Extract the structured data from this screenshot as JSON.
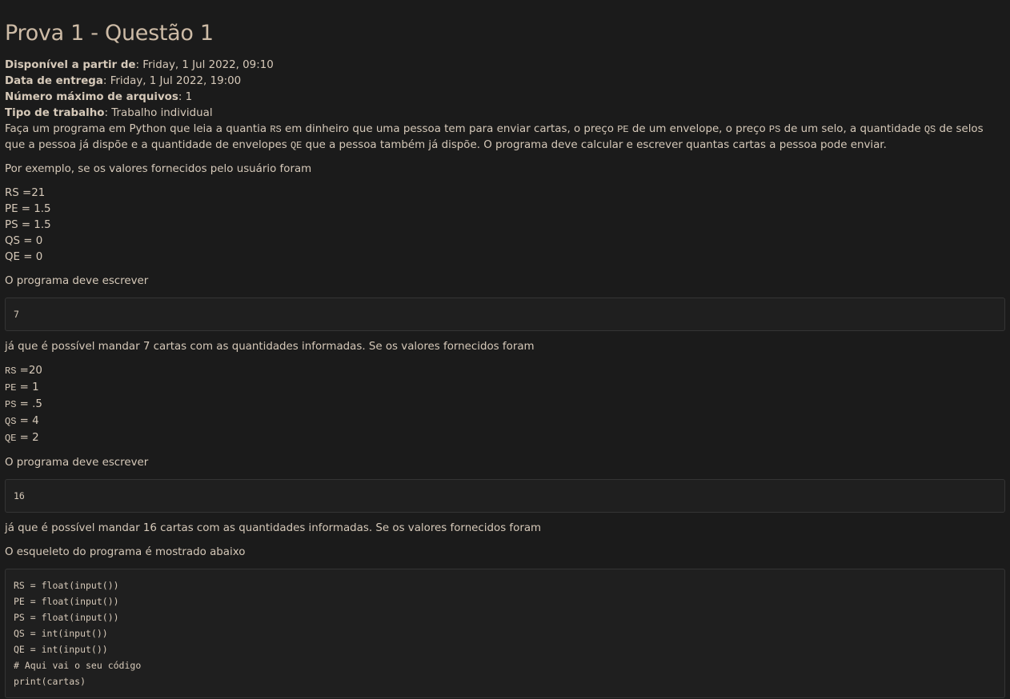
{
  "title": "Prova 1 - Questão 1",
  "meta": [
    {
      "label": "Disponível a partir de",
      "value": "Friday, 1 Jul 2022, 09:10"
    },
    {
      "label": "Data de entrega",
      "value": "Friday, 1 Jul 2022, 19:00"
    },
    {
      "label": "Número máximo de arquivos",
      "value": "1"
    },
    {
      "label": "Tipo de trabalho",
      "value": "Trabalho individual"
    }
  ],
  "description": {
    "t1": "Faça um programa em Python que leia a quantia ",
    "c1": "RS",
    "t2": " em dinheiro que uma pessoa tem para enviar cartas, o preço ",
    "c2": "PE",
    "t3": " de um envelope, o preço ",
    "c3": "PS",
    "t4": " de um selo, a quantidade ",
    "c4": " QS",
    "t5": " de selos que a pessoa já dispõe e a quantidade de envelopes ",
    "c5": " QE",
    "t6": " que a pessoa também já dispõe. O programa deve calcular e escrever quantas cartas a pessoa pode enviar."
  },
  "example_intro": "Por exemplo, se os valores fornecidos pelo usuário foram",
  "example1_vars": [
    "RS =21",
    "PE = 1.5",
    "PS = 1.5",
    "QS = 0",
    "QE = 0"
  ],
  "should_write": "O programa deve escrever",
  "output1": "7",
  "after1": "já que é possível mandar 7 cartas com as quantidades informadas. Se os valores fornecidos foram",
  "example2_vars": [
    {
      "name": "RS",
      "value": " =20"
    },
    {
      "name": "PE",
      "value": " = 1"
    },
    {
      "name": "PS",
      "value": " = .5"
    },
    {
      "name": "QS",
      "value": " = 4"
    },
    {
      "name": "QE",
      "value": " = 2"
    }
  ],
  "should_write2": "O programa deve escrever",
  "output2": "16",
  "after2": "já que é possível mandar 16 cartas com as quantidades informadas. Se os valores fornecidos foram",
  "skeleton_intro": "O esqueleto do programa é mostrado abaixo",
  "skeleton_code": [
    "RS = float(input())",
    "PE = float(input())",
    "PS = float(input())",
    "QS = int(input())",
    "QE = int(input())",
    "# Aqui vai o seu código",
    "print(cartas)"
  ]
}
